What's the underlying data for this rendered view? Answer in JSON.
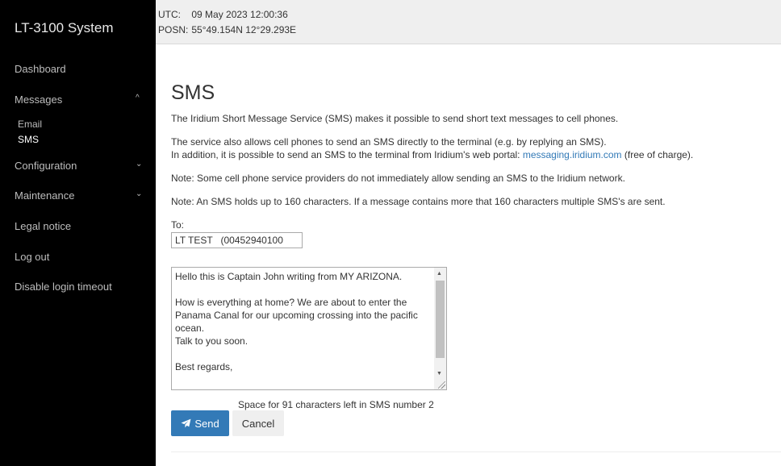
{
  "sidebar": {
    "brand": "LT-3100 System",
    "items": [
      {
        "label": "Dashboard"
      },
      {
        "label": "Messages",
        "chevron": "^"
      },
      {
        "label": "Email"
      },
      {
        "label": "SMS"
      },
      {
        "label": "Configuration",
        "chevron": "⌄"
      },
      {
        "label": "Maintenance",
        "chevron": "⌄"
      },
      {
        "label": "Legal notice"
      },
      {
        "label": "Log out"
      },
      {
        "label": "Disable login timeout"
      }
    ]
  },
  "status": {
    "utc_label": "UTC:",
    "utc_value": "09 May 2023 12:00:36",
    "posn_label": "POSN:",
    "posn_value": "55°49.154N 12°29.293E"
  },
  "main": {
    "title": "SMS",
    "p1": "The Iridium Short Message Service (SMS) makes it possible to send short text messages to cell phones.",
    "p2a": "The service also allows cell phones to send an SMS directly to the terminal (e.g. by replying an SMS).",
    "p2b_prefix": "In addition, it is possible to send an SMS to the terminal from Iridium's web portal: ",
    "p2b_link": "messaging.iridium.com",
    "p2b_suffix": " (free of charge).",
    "note1": "Note: Some cell phone service providers do not immediately allow sending an SMS to the Iridium network.",
    "note2": "Note: An SMS holds up to 160 characters. If a message contains more that 160 characters multiple SMS's are sent.",
    "to_label": "To:",
    "to_value": "LT TEST   (00452940100",
    "message": "Hello this is Captain John writing from MY ARIZONA.\n\nHow is everything at home? We are about to enter the Panama Canal for our upcoming crossing into the pacific ocean.\nTalk to you soon.\n\nBest regards,",
    "counter": "Space for 91 characters left in SMS number 2",
    "send_label": "Send",
    "cancel_label": "Cancel"
  },
  "icons": {
    "send": "paper-plane-icon"
  }
}
